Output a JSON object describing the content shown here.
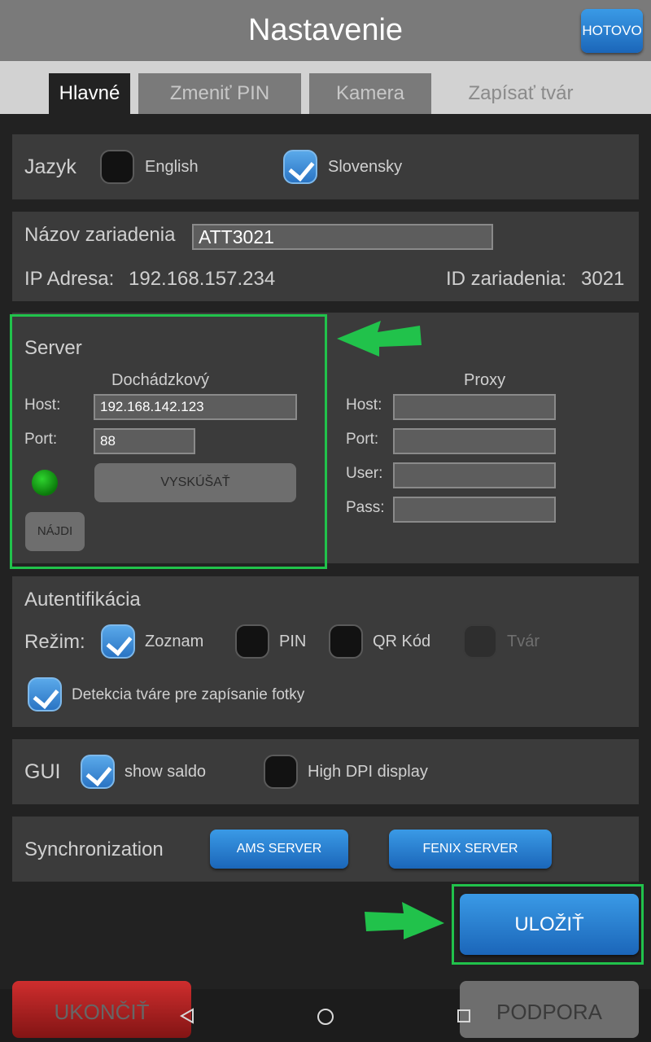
{
  "header": {
    "title": "Nastavenie",
    "done_label": "HOTOVO"
  },
  "tabs": [
    {
      "label": "Hlavné"
    },
    {
      "label": "Zmeniť PIN"
    },
    {
      "label": "Kamera"
    },
    {
      "label": "Zapísať tvár"
    }
  ],
  "language": {
    "label": "Jazyk",
    "options": [
      {
        "label": "English",
        "checked": false
      },
      {
        "label": "Slovensky",
        "checked": true
      }
    ]
  },
  "device": {
    "name_label": "Názov zariadenia",
    "name_value": "ATT3021",
    "ip_label": "IP Adresa:",
    "ip_value": "192.168.157.234",
    "id_label": "ID zariadenia:",
    "id_value": "3021"
  },
  "server": {
    "title": "Server",
    "attendance": {
      "title": "Dochádzkový",
      "host_label": "Host:",
      "host_value": "192.168.142.123",
      "port_label": "Port:",
      "port_value": "88",
      "test_label": "VYSKÚŠAŤ",
      "find_label": "NÁJDI",
      "status_color": "#1fb81f"
    },
    "proxy": {
      "title": "Proxy",
      "host_label": "Host:",
      "port_label": "Port:",
      "user_label": "User:",
      "pass_label": "Pass:"
    }
  },
  "auth": {
    "title": "Autentifikácia",
    "mode_label": "Režim:",
    "modes": [
      {
        "label": "Zoznam",
        "checked": true
      },
      {
        "label": "PIN",
        "checked": false
      },
      {
        "label": "QR Kód",
        "checked": false
      },
      {
        "label": "Tvár",
        "checked": false,
        "disabled": true
      }
    ],
    "face_detect_label": "Detekcia tváre pre zapísanie fotky",
    "face_detect_checked": true
  },
  "gui": {
    "label": "GUI",
    "show_saldo_label": "show saldo",
    "show_saldo_checked": true,
    "high_dpi_label": "High DPI display",
    "high_dpi_checked": false
  },
  "sync": {
    "label": "Synchronization",
    "ams_label": "AMS SERVER",
    "fenix_label": "FENIX SERVER"
  },
  "actions": {
    "save_label": "ULOŽIŤ",
    "exit_label": "UKONČIŤ",
    "support_label": "PODPORA"
  },
  "colors": {
    "accent_blue": "#2a82d4",
    "highlight_green": "#21c24b",
    "exit_red": "#d22a2a"
  }
}
